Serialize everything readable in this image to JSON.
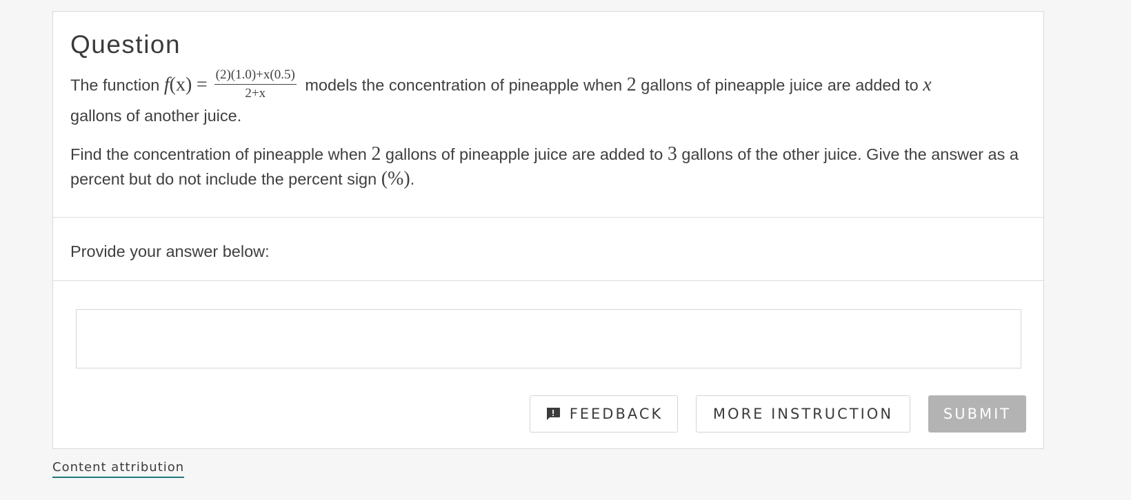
{
  "question": {
    "title": "Question",
    "para1": {
      "before_function": "The function ",
      "function_name": "f",
      "function_arg": "(x)",
      "equals": "=",
      "numerator": "(2)(1.0)+x(0.5)",
      "denominator": "2+x",
      "text_a": " models the concentration of pineapple when ",
      "num_a": "2",
      "text_b": " gallons of pineapple juice are added to ",
      "var_x": "x",
      "text_c": " gallons of another juice."
    },
    "para2": {
      "text_a": "Find the concentration of pineapple when ",
      "num_a": "2",
      "text_b": " gallons of pineapple juice are added to ",
      "num_b": "3",
      "text_c": " gallons of the other juice. Give the answer as a percent but do not include the percent sign ",
      "percent_sign": "(%)",
      "text_d": "."
    }
  },
  "answer": {
    "label": "Provide your answer below:",
    "value": "",
    "placeholder": ""
  },
  "buttons": {
    "feedback": "FEEDBACK",
    "more_instruction": "MORE INSTRUCTION",
    "submit": "SUBMIT"
  },
  "footer": {
    "attribution": "Content attribution"
  },
  "icons": {
    "feedback": "feedback-icon"
  },
  "colors": {
    "page_background": "#f6f6f6",
    "submit_disabled": "#b3b3b3",
    "attribution_underline": "#1e7a7a"
  }
}
